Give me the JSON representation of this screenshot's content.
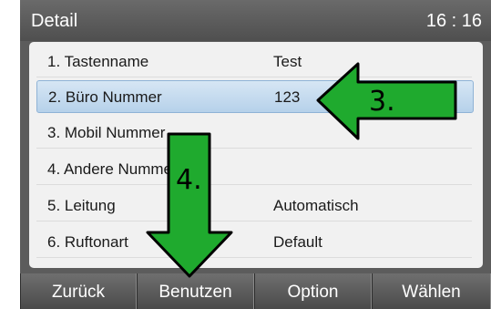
{
  "header": {
    "title": "Detail",
    "time": "16 : 16"
  },
  "rows": [
    {
      "label": "1. Tastenname",
      "value": "Test"
    },
    {
      "label": "2. Büro Nummer",
      "value": "123"
    },
    {
      "label": "3. Mobil Nummer",
      "value": ""
    },
    {
      "label": "4. Andere Nummer",
      "value": ""
    },
    {
      "label": "5. Leitung",
      "value": "Automatisch"
    },
    {
      "label": "6. Ruftonart",
      "value": "Default"
    }
  ],
  "selected_row": 2,
  "softkeys": [
    "Zurück",
    "Benutzen",
    "Option",
    "Wählen"
  ],
  "annotations": [
    {
      "label": "3.",
      "icon": "arrow-left-icon",
      "color": "#1faa2e"
    },
    {
      "label": "4.",
      "icon": "arrow-down-icon",
      "color": "#1faa2e"
    }
  ]
}
